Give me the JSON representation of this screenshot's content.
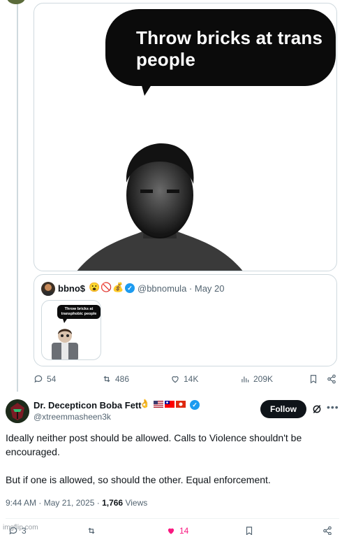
{
  "media": {
    "bubble_text": "Throw bricks at trans people"
  },
  "quote": {
    "author_name": "bbno$",
    "author_emojis": "😮🚫💰",
    "author_handle": "@bbnomula",
    "date": "May 20",
    "thumb_bubble_text": "Throw bricks at transphobic people"
  },
  "upper_actions": {
    "replies": "54",
    "reposts": "486",
    "likes": "14K",
    "views": "209K"
  },
  "tweet": {
    "author_name": "Dr. Decepticon Boba Fett",
    "author_handle": "@xtreemmasheen3k",
    "follow_label": "Follow",
    "paragraph_1": "Ideally neither post should be allowed. Calls to Violence shouldn't be encouraged.",
    "paragraph_2": "But if one is allowed, so should the other. Equal enforcement.",
    "timestamp": "9:44 AM · May 21, 2025 · ",
    "views_count": "1,766",
    "views_label": " Views"
  },
  "bottom_actions": {
    "replies": "3",
    "likes": "14"
  },
  "watermark": "imgflip.com",
  "colors": {
    "accent_blue": "#1d9bf0",
    "like_pink": "#f91880",
    "muted_text": "#536471"
  }
}
